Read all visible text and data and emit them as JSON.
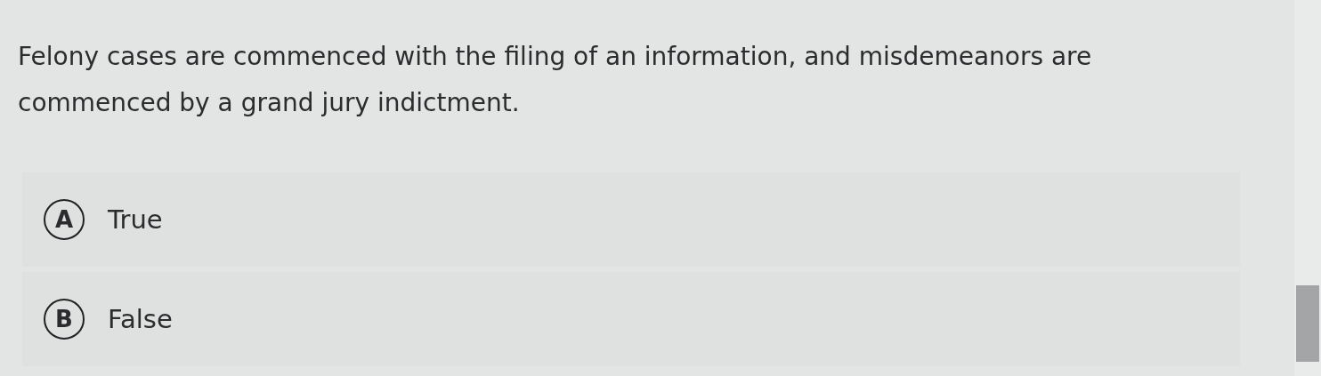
{
  "question": {
    "text": "Felony cases are commenced with the filing of an information, and misdemeanors are commenced by a grand jury indictment."
  },
  "options": [
    {
      "letter": "A",
      "label": "True",
      "selected": false
    },
    {
      "letter": "B",
      "label": "False",
      "selected": false
    }
  ]
}
